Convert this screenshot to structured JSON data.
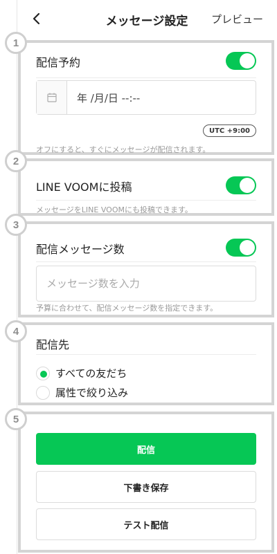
{
  "header": {
    "title": "メッセージ設定",
    "preview_label": "プレビュー"
  },
  "badges": [
    "1",
    "2",
    "3",
    "4",
    "5"
  ],
  "schedule": {
    "label": "配信予約",
    "toggle_on": true,
    "date_value": "年 /月/日 --:--",
    "timezone": "UTC +9:00",
    "hint": "オフにすると、すぐにメッセージが配信されます。"
  },
  "voom": {
    "label": "LINE VOOMに投稿",
    "toggle_on": true,
    "hint": "メッセージをLINE VOOMにも投稿できます。"
  },
  "count": {
    "label": "配信メッセージ数",
    "toggle_on": true,
    "placeholder": "メッセージ数を入力",
    "hint": "予算に合わせて、配信メッセージ数を指定できます。"
  },
  "recipients": {
    "label": "配信先",
    "options": [
      {
        "label": "すべての友だち",
        "selected": true
      },
      {
        "label": "属性で絞り込み",
        "selected": false
      }
    ]
  },
  "actions": {
    "send_label": "配信",
    "draft_label": "下書き保存",
    "test_label": "テスト配信"
  },
  "colors": {
    "accent": "#06c755",
    "badge_border": "#cfcfcf",
    "section_border": "#d4d4d4"
  }
}
